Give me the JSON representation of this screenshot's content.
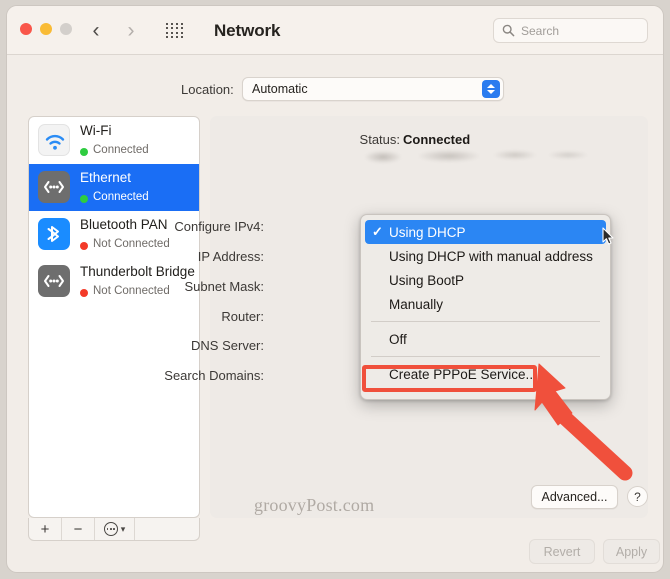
{
  "window": {
    "title": "Network",
    "traffic_lights": [
      "close",
      "minimize",
      "zoom"
    ],
    "nav_back_icon": "chevron-left-icon",
    "nav_forward_icon": "chevron-right-icon",
    "grid_icon": "apps-grid-icon"
  },
  "search": {
    "placeholder": "Search",
    "value": "",
    "icon": "search-icon"
  },
  "location": {
    "label": "Location:",
    "value": "Automatic",
    "stepper_icon": "up-down-chevrons-icon"
  },
  "sidebar": {
    "items": [
      {
        "name": "Wi-Fi",
        "status": "Connected",
        "connected": true,
        "icon": "wifi-icon"
      },
      {
        "name": "Ethernet",
        "status": "Connected",
        "connected": true,
        "icon": "ethernet-icon",
        "selected": true
      },
      {
        "name": "Bluetooth PAN",
        "status": "Not Connected",
        "connected": false,
        "icon": "bluetooth-icon"
      },
      {
        "name": "Thunderbolt Bridge",
        "status": "Not Connected",
        "connected": false,
        "icon": "ethernet-icon"
      }
    ],
    "footer": {
      "add_label": "+",
      "remove_label": "−",
      "menu_icon": "ellipsis-circle-icon",
      "menu_chevron_icon": "chevron-down-icon"
    }
  },
  "main": {
    "status_label": "Status:",
    "status_value": "Connected",
    "status_detail_redacted": true,
    "fields": [
      {
        "label": "Configure IPv4:",
        "value_redacted": false
      },
      {
        "label": "IP Address:",
        "value_redacted": true
      },
      {
        "label": "Subnet Mask:",
        "value_redacted": true
      },
      {
        "label": "Router:",
        "value_redacted": true
      },
      {
        "label": "DNS Server:",
        "value_redacted": true
      },
      {
        "label": "Search Domains:",
        "value_redacted": true
      }
    ],
    "advanced_label": "Advanced...",
    "help_label": "?",
    "revert_label": "Revert",
    "apply_label": "Apply"
  },
  "popup_menu": {
    "open": true,
    "check_icon": "checkmark-icon",
    "items": [
      {
        "label": "Using DHCP",
        "checked": true,
        "highlighted": true
      },
      {
        "label": "Using DHCP with manual address",
        "checked": false,
        "highlighted": false
      },
      {
        "label": "Using BootP",
        "checked": false,
        "highlighted": false
      },
      {
        "label": "Manually",
        "checked": false,
        "highlighted": false
      },
      {
        "separator": true
      },
      {
        "label": "Off",
        "checked": false,
        "highlighted": false
      },
      {
        "separator": true
      },
      {
        "label": "Create PPPoE Service...",
        "checked": false,
        "highlighted": false,
        "annotated": true
      }
    ]
  },
  "annotation": {
    "highlight_color": "#f0503c",
    "arrow_color": "#f0503c",
    "target_label": "Create PPPoE Service..."
  },
  "watermark": {
    "text": "groovyPost.com"
  },
  "colors": {
    "accent_blue": "#1a6ef5",
    "menu_highlight": "#2b86f3",
    "connected_green": "#2ecc40",
    "disconnected_red": "#f33a28",
    "annotation_red": "#f0503c",
    "window_bg": "#f2ede8"
  }
}
